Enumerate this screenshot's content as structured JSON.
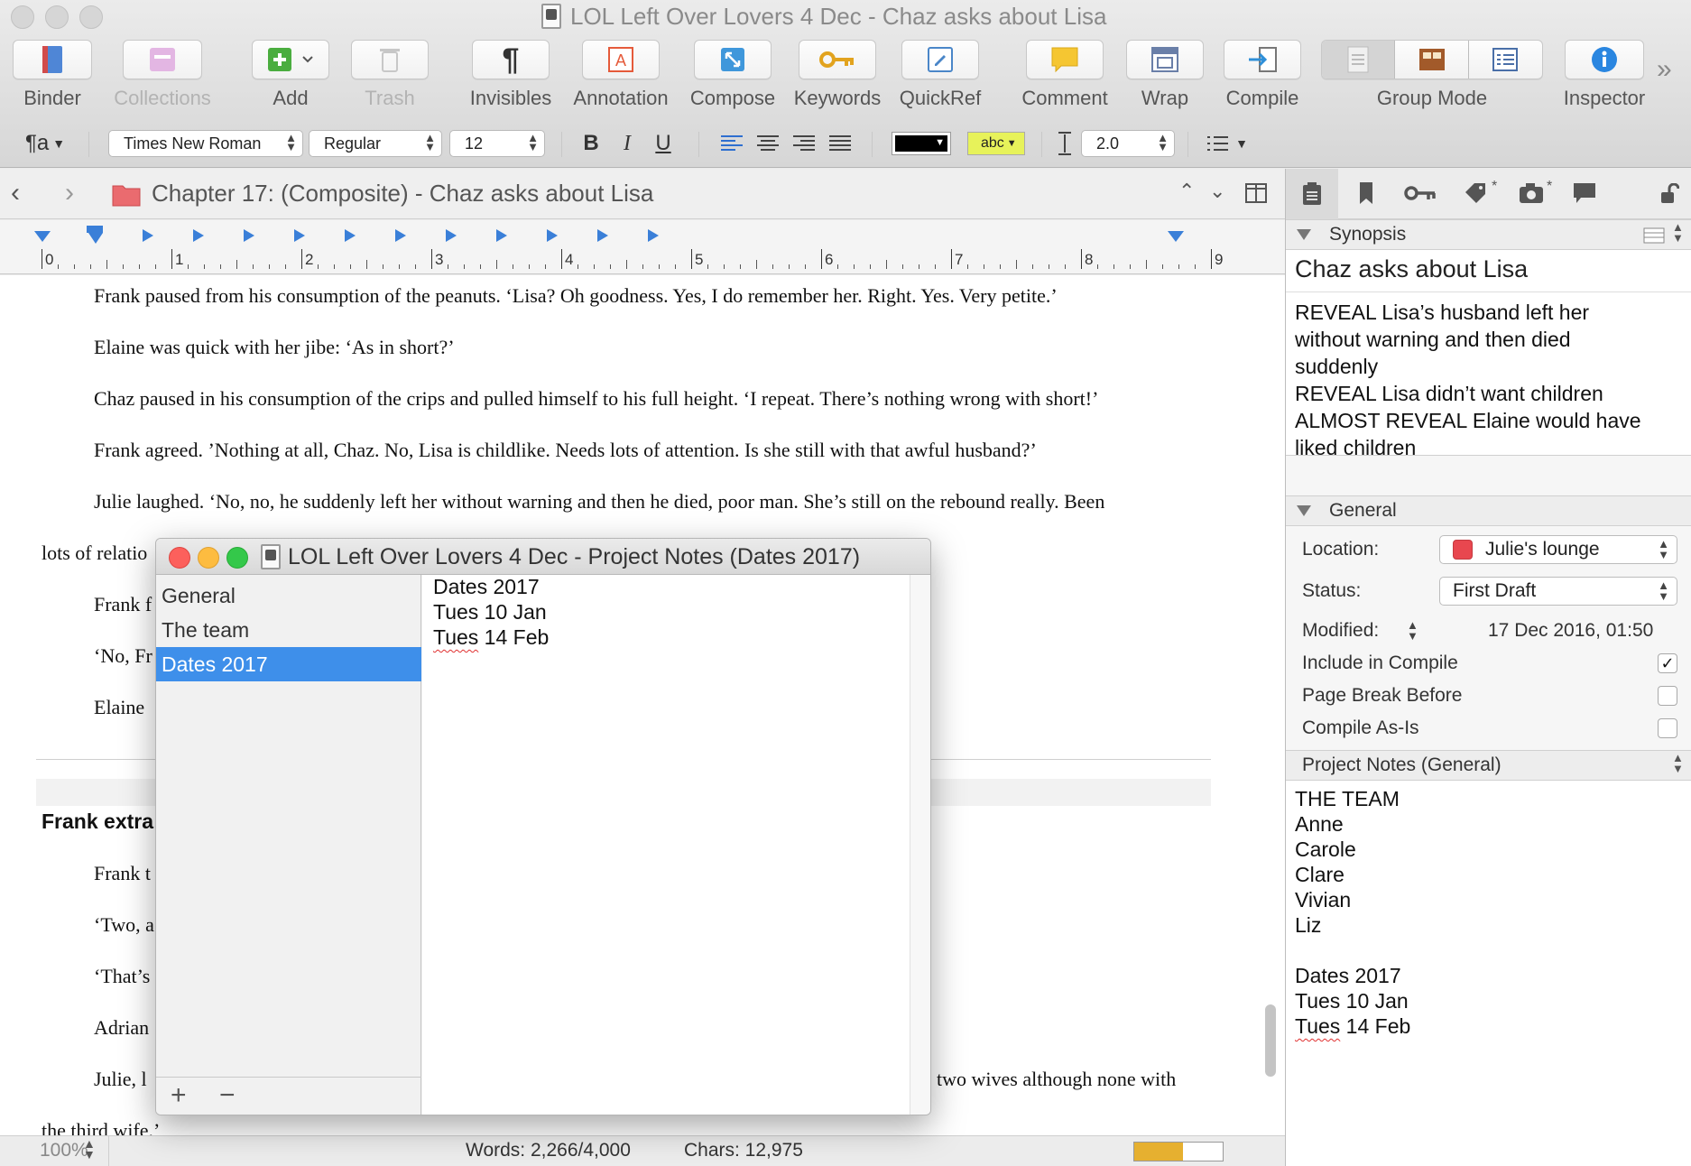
{
  "window": {
    "title": "LOL Left Over Lovers  4 Dec - Chaz asks about Lisa"
  },
  "toolbar": {
    "binder": "Binder",
    "collections": "Collections",
    "add": "Add",
    "trash": "Trash",
    "invisibles": "Invisibles",
    "annotation": "Annotation",
    "compose": "Compose",
    "keywords": "Keywords",
    "quickref": "QuickRef",
    "comment": "Comment",
    "wrap": "Wrap",
    "compile": "Compile",
    "group_mode": "Group Mode",
    "inspector": "Inspector",
    "overflow": "»"
  },
  "format_bar": {
    "paragraph_style": "¶a",
    "font_family": "Times New Roman",
    "font_style": "Regular",
    "font_size": "12",
    "bold": "B",
    "italic": "I",
    "underline": "U",
    "highlight_label": "abc",
    "line_spacing": "2.0"
  },
  "editor": {
    "header_title": "Chapter 17:  (Composite) - Chaz asks about Lisa",
    "ruler_numbers": [
      "0",
      "1",
      "2",
      "3",
      "4",
      "5",
      "6",
      "7",
      "8",
      "9"
    ],
    "paragraphs": [
      "Frank paused from his consumption of the peanuts. ‘Lisa? Oh goodness. Yes, I do remember her. Right. Yes. Very petite.’",
      "Elaine was quick with her jibe: ‘As in short?’",
      "Chaz paused in his consumption of the crips and pulled himself to his full height. ‘I repeat. There’s nothing wrong with short!’",
      "Frank agreed. ’Nothing at all, Chaz. No, Lisa is childlike. Needs lots of attention. Is she still with that awful husband?’",
      "Julie laughed. ‘No, no, he suddenly left her without warning and then he died, poor man. She’s still on the rebound really. Been"
    ],
    "partial_lines": {
      "relatio": "lots of relatio",
      "frank_f": "Frank f",
      "no_fr": "‘No, Fr",
      "elaine": "Elaine",
      "frank_extra_heading": "Frank extra",
      "frank_t": "Frank t",
      "two_a": "‘Two, a",
      "thats": "‘That’s",
      "adrian": "Adrian",
      "julie_l": "Julie, l",
      "two_wives": "two wives although none with",
      "third_wife": "the third wife.’"
    }
  },
  "status_bar": {
    "zoom": "100%",
    "words": "Words: 2,266/4,000",
    "chars": "Chars: 12,975",
    "progress": 0.55
  },
  "inspector": {
    "synopsis_header": "Synopsis",
    "synopsis_title": "Chaz asks about Lisa",
    "synopsis_lines": [
      "REVEAL Lisa’s husband left her",
      "without warning and then died",
      "suddenly",
      "REVEAL Lisa didn’t want children",
      "ALMOST REVEAL Elaine would have",
      "liked children"
    ],
    "general_header": "General",
    "location_label": "Location:",
    "location_value": "Julie's lounge",
    "status_label": "Status:",
    "status_value": "First Draft",
    "modified_label": "Modified:",
    "modified_value": "17 Dec 2016, 01:50",
    "include_compile": "Include in Compile",
    "page_break_before": "Page Break Before",
    "compile_as_is": "Compile As-Is",
    "project_notes_header": "Project Notes (General)",
    "project_notes_lines": [
      "THE TEAM",
      "Anne",
      "Carole",
      "Clare",
      "Vivian",
      "Liz",
      "",
      "Dates 2017",
      "Tues 10 Jan",
      "Tues 14 Feb"
    ]
  },
  "notes_window": {
    "title": "LOL Left Over Lovers  4 Dec - Project Notes (Dates 2017)",
    "list": [
      "General",
      "The team",
      "Dates 2017"
    ],
    "selected_index": 2,
    "content_lines": [
      "Dates 2017",
      "Tues 10 Jan",
      "Tues 14 Feb"
    ],
    "add_button": "+",
    "remove_button": "−"
  },
  "colors": {
    "accent_blue": "#3e8fea",
    "location_label_red": "#e8474f",
    "highlight_yellow": "#e7f25a",
    "progress_fill": "#e6b030"
  }
}
